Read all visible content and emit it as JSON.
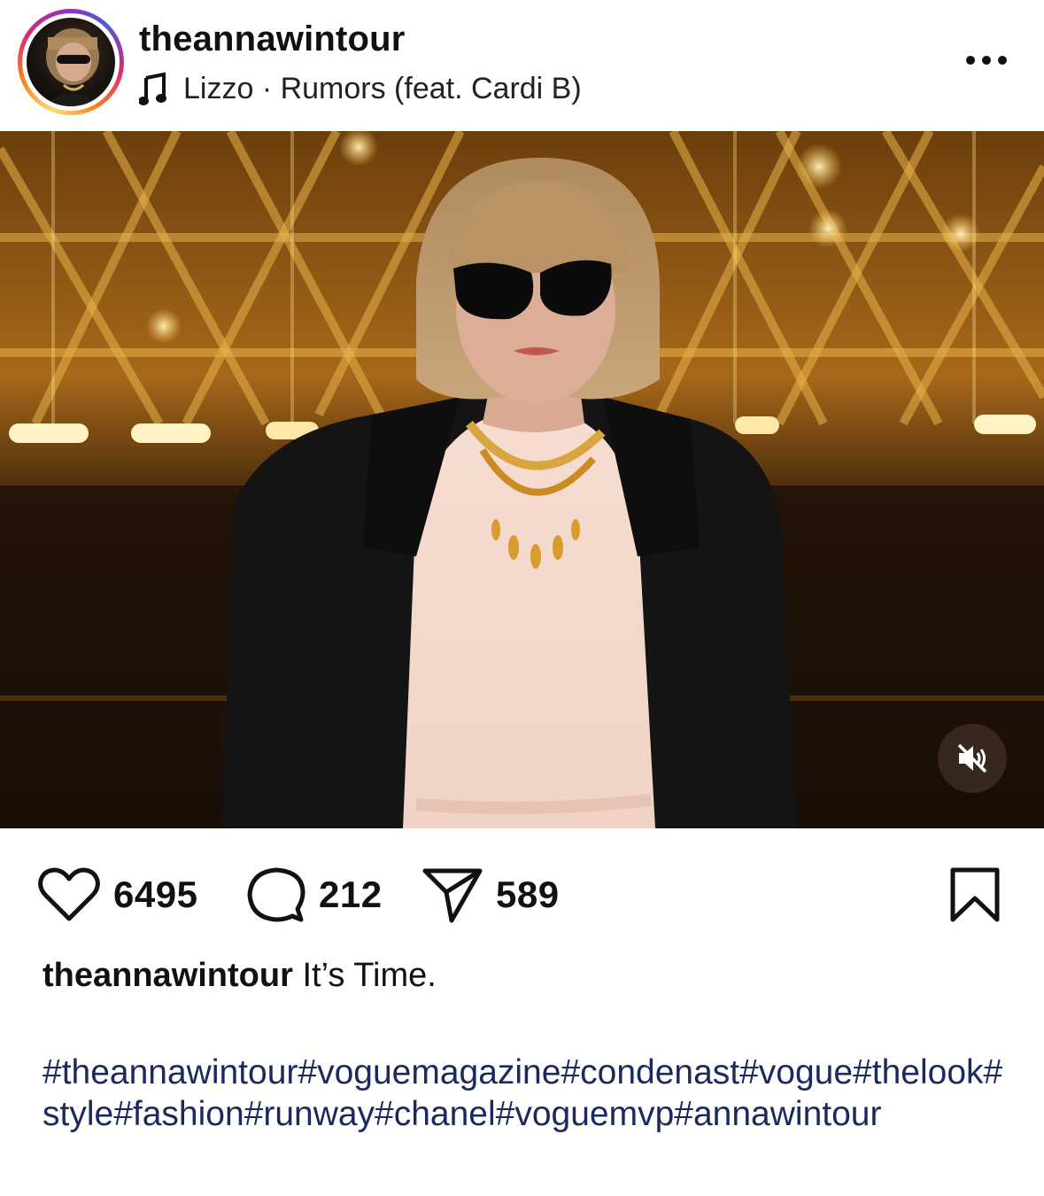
{
  "post": {
    "username": "theannawintour",
    "music": "Lizzo · Rumors (feat. Cardi B)",
    "icons": {
      "more": "more-options-icon",
      "music": "music-note-icon",
      "mute": "muted-speaker-icon",
      "like": "heart-icon",
      "comment": "comment-bubble-icon",
      "share": "send-icon",
      "save": "bookmark-icon"
    }
  },
  "stats": {
    "likes": "6495",
    "comments": "212",
    "shares": "589"
  },
  "caption": {
    "username": "theannawintour",
    "text": "It’s Time.",
    "hashtags": "#theannawintour#voguemagazine#condenast#vogue#thelook#style#fashion#runway#chanel#voguemvp#annawintour"
  },
  "colors": {
    "hashtag": "#1a2a5e",
    "mute_button_bg": "#3c2d23"
  }
}
